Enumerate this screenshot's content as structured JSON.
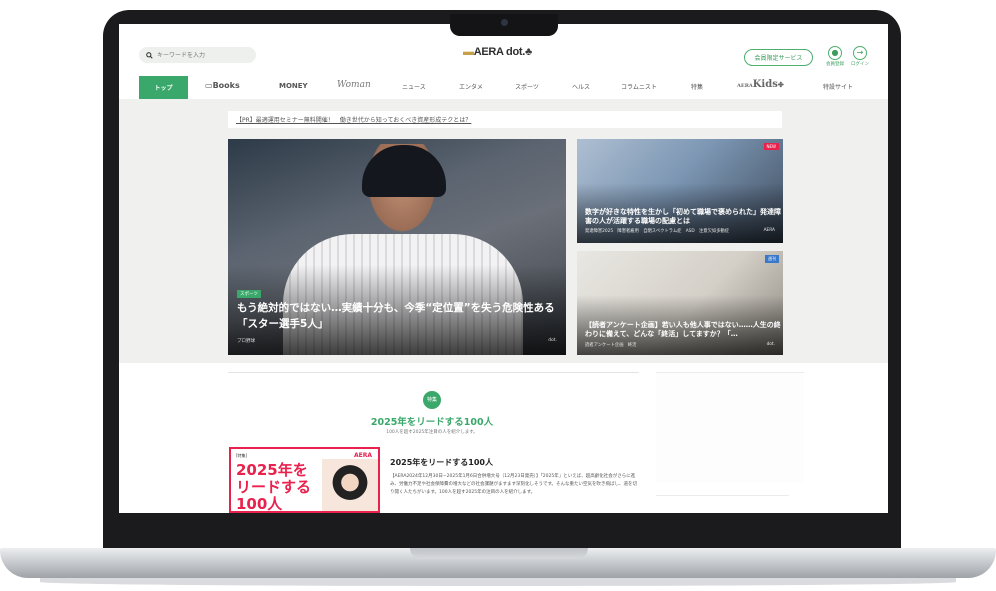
{
  "header": {
    "search_placeholder": "キーワードを入力",
    "logo": "AERA dot.",
    "member_button": "会員限定サービス",
    "register_label": "会員登録",
    "login_label": "ログイン"
  },
  "nav": {
    "items": [
      "トップ",
      "Books",
      "MONEY",
      "Woman",
      "ニュース",
      "エンタメ",
      "スポーツ",
      "ヘルス",
      "コラムニスト",
      "特集",
      "Kids",
      "特設サイト"
    ],
    "kids_prefix": "AERA",
    "active_index": 0
  },
  "pr_banner": "【PR】最適運用セミナー無料開催！　働き世代から知っておくべき資産形成テクとは？",
  "main_story": {
    "tag": "スポーツ",
    "title": "もう絶対的ではない…実績十分も、今季“定位置”を失う危険性ある「スター選手5人」",
    "category": "プロ野球",
    "source": "dot."
  },
  "side_stories": [
    {
      "badge": "NEW",
      "title": "数字が好きな特性を生かし「初めて職場で褒められた」発達障害の人が活躍する職場の配慮とは",
      "meta": "発達障害2025　障害者雇用　自閉スペクトラム症　ASD　注意欠如多動症",
      "source": "AERA"
    },
    {
      "badge": "週刊",
      "title": "【読者アンケート企画】若い人も他人事ではない……人生の終わりに備えて、どんな「終活」してますか？「…",
      "meta": "読者アンケート企画　終活",
      "source": "dot."
    }
  ],
  "feature": {
    "icon_label": "特集",
    "title": "2025年をリードする100人",
    "subtitle": "100人を超す2025年注目の人を紹介します。",
    "image_tag": "[特集]",
    "image_brand": "AERA",
    "image_headline": "2025年をリードする100人",
    "article_title": "2025年をリードする100人",
    "article_body": "【AERA2024年12月30日−2025年1月6日合併増大号（12月23日発売）】「2025年」といえば、超高齢化社会がさらに進み、労働力不足や社会保障費の増大などの社会課題がますます深刻化しそうです。そんな重たい空気を吹き飛ばし、道を切り開く人たちがいます。100人を超す2025年の注目の人を紹介します。"
  },
  "colors": {
    "accent": "#3aa86a",
    "aera_red": "#e8214d",
    "bezel": "#1b1b1d"
  }
}
